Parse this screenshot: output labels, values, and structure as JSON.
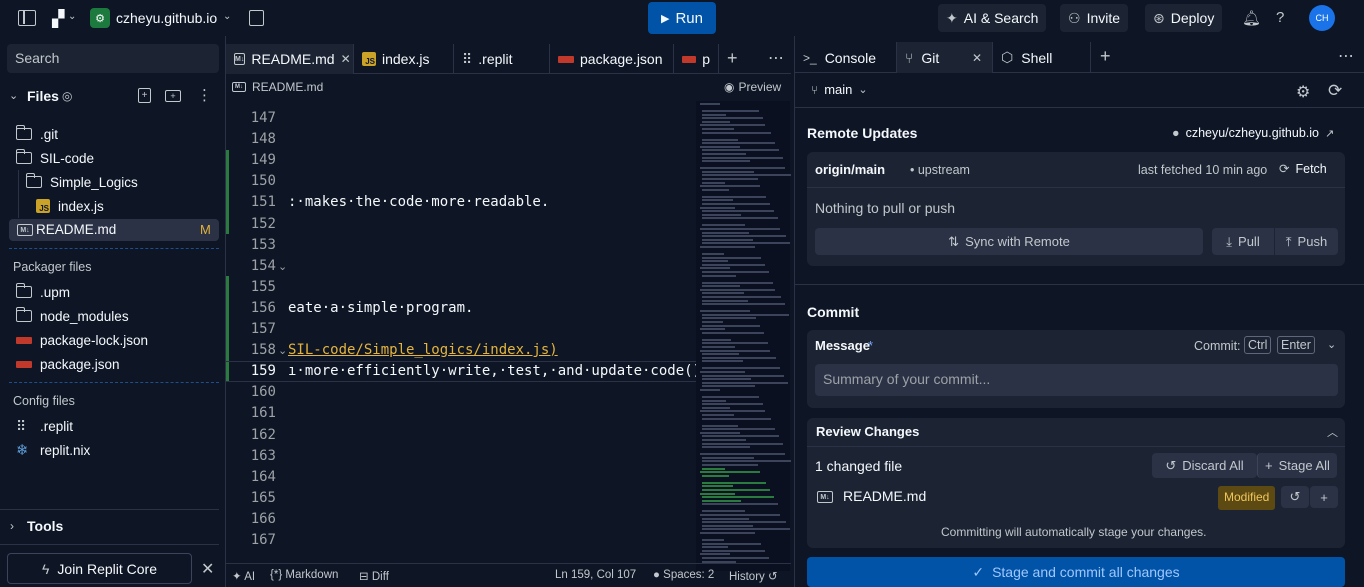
{
  "topbar": {
    "repl_name": "czheyu.github.io",
    "run_label": "Run",
    "ai_search_label": "AI & Search",
    "invite_label": "Invite",
    "deploy_label": "Deploy",
    "avatar_initials": "CH"
  },
  "sidebar": {
    "search_placeholder": "Search",
    "files_title": "Files",
    "tree": [
      {
        "label": ".git",
        "type": "folder"
      },
      {
        "label": "SIL-code",
        "type": "folder"
      },
      {
        "label": "Simple_Logics",
        "type": "folder"
      },
      {
        "label": "index.js",
        "type": "js"
      },
      {
        "label": "README.md",
        "type": "md",
        "badge": "M"
      }
    ],
    "packager_title": "Packager files",
    "packager": [
      {
        "label": ".upm",
        "type": "folder"
      },
      {
        "label": "node_modules",
        "type": "folder"
      },
      {
        "label": "package-lock.json",
        "type": "npm"
      },
      {
        "label": "package.json",
        "type": "npm"
      }
    ],
    "config_title": "Config files",
    "config": [
      {
        "label": ".replit",
        "type": "replit"
      },
      {
        "label": "replit.nix",
        "type": "nix"
      }
    ],
    "tools_label": "Tools",
    "join_label": "Join Replit Core"
  },
  "editor": {
    "tabs": [
      "README.md",
      "index.js",
      ".replit",
      "package.json",
      "p"
    ],
    "breadcrumb": "README.md",
    "preview_label": "Preview",
    "lines": [
      {
        "n": "147",
        "text": ""
      },
      {
        "n": "148",
        "text": ""
      },
      {
        "n": "149",
        "text": ""
      },
      {
        "n": "150",
        "text": ""
      },
      {
        "n": "151",
        "text": ":·makes·the·code·more·readable."
      },
      {
        "n": "152",
        "text": ""
      },
      {
        "n": "153",
        "text": ""
      },
      {
        "n": "154",
        "text": ""
      },
      {
        "n": "155",
        "text": ""
      },
      {
        "n": "156",
        "text": "eate·a·simple·program."
      },
      {
        "n": "157",
        "text": ""
      },
      {
        "n": "158",
        "text": "SIL-code/Simple_logics/index.js)"
      },
      {
        "n": "159",
        "text": "ı·more·efficiently·write,·test,·and·update·code()"
      },
      {
        "n": "160",
        "text": ""
      },
      {
        "n": "161",
        "text": ""
      },
      {
        "n": "162",
        "text": ""
      },
      {
        "n": "163",
        "text": ""
      },
      {
        "n": "164",
        "text": ""
      },
      {
        "n": "165",
        "text": ""
      },
      {
        "n": "166",
        "text": ""
      },
      {
        "n": "167",
        "text": ""
      }
    ],
    "status": {
      "ai": "AI",
      "lang": "Markdown",
      "diff": "Diff",
      "position": "Ln 159, Col 107",
      "spaces": "Spaces: 2",
      "history": "History"
    }
  },
  "right": {
    "tabs": [
      "Console",
      "Git",
      "Shell"
    ],
    "branch": "main",
    "remote_title": "Remote Updates",
    "repo_link": "czheyu/czheyu.github.io",
    "origin": "origin/main",
    "upstream": "• upstream",
    "last_fetched": "last fetched 10 min ago",
    "fetch_label": "Fetch",
    "nothing_label": "Nothing to pull or push",
    "sync_label": "Sync with Remote",
    "pull_label": "Pull",
    "push_label": "Push",
    "commit_title": "Commit",
    "message_label": "Message",
    "required_mark": "*",
    "commit_shortcut_label": "Commit:",
    "key_ctrl": "Ctrl",
    "key_enter": "Enter",
    "summary_placeholder": "Summary of your commit...",
    "review_title": "Review Changes",
    "changed_count": "1 changed file",
    "discard_label": "Discard All",
    "stage_all_label": "Stage All",
    "changed_file": "README.md",
    "modified_label": "Modified",
    "note": "Committing will automatically stage your changes.",
    "stage_commit_label": "Stage and commit all changes"
  }
}
